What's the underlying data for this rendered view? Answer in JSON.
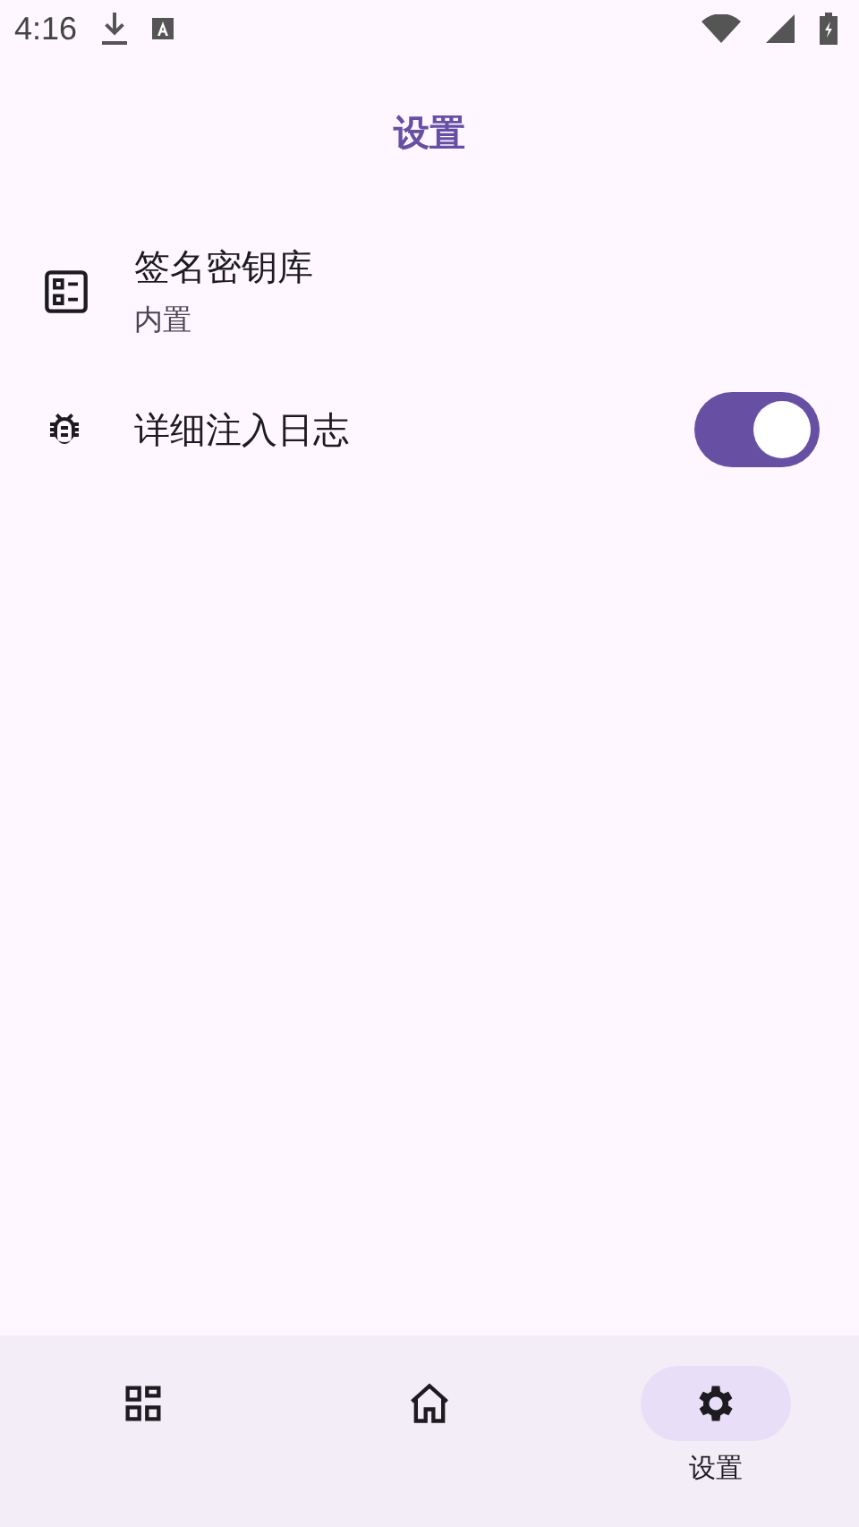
{
  "status_bar": {
    "time": "4:16"
  },
  "top_bar": {
    "title": "设置"
  },
  "settings": [
    {
      "kind": "keystore",
      "title": "签名密钥库",
      "subtitle": "内置"
    },
    {
      "kind": "toggle",
      "title": "详细注入日志",
      "on": true
    }
  ],
  "bottom_nav": [
    {
      "kind": "apps",
      "selected": false
    },
    {
      "kind": "home",
      "selected": false
    },
    {
      "kind": "settings",
      "selected": true,
      "label": "设置"
    }
  ]
}
